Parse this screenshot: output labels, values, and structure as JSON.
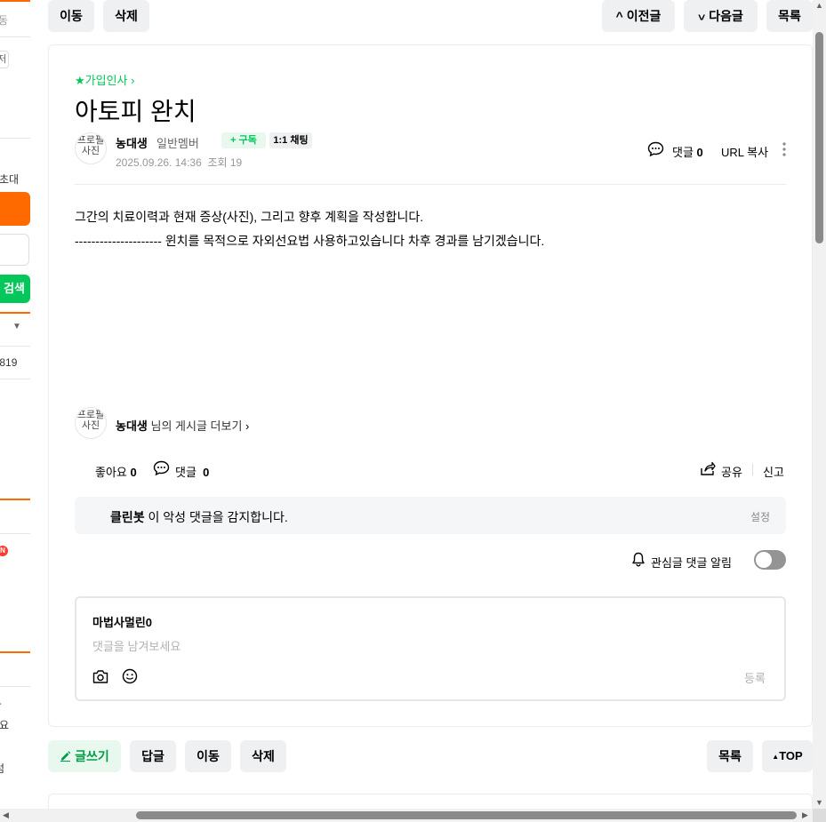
{
  "sidebar": {
    "snippets": [
      "동",
      "니저",
      "초대",
      "검색",
      "819",
      "N",
      "요",
      "럼"
    ]
  },
  "top_bar": {
    "move_label": "이동",
    "delete_label": "삭제",
    "prev_label": "이전글",
    "next_label": "다음글",
    "list_label": "목록"
  },
  "post": {
    "board_link": "★가입인사",
    "title": "아토피 완치",
    "avatar_alt": "프로필 사진",
    "author": "농대생",
    "member_level": "일반멤버",
    "subscribe_label": "구독",
    "chat_label": "1:1 채팅",
    "date": "2025.09.26. 14:36",
    "views_label": "조회",
    "views": "19",
    "comment_label": "댓글",
    "comment_count": "0",
    "url_copy_label": "URL 복사",
    "body_line1": "그간의 치료이력과 현재 증상(사진), 그리고 향후 계획을 작성합니다.",
    "body_line2": "--------------------- 윈치를 목적으로 자외선요법 사용하고있습니다 차후 경과를 남기겠습니다.",
    "more_posts_suffix": "님의 게시글 더보기"
  },
  "reactions": {
    "like_label": "좋아요",
    "like_count": "0",
    "comment_label": "댓글",
    "comment_count": "0",
    "share_label": "공유",
    "report_label": "신고"
  },
  "cleanbot": {
    "name": "클린봇",
    "text": "이 악성 댓글을 감지합니다.",
    "settings_label": "설정"
  },
  "notify": {
    "label": "관심글 댓글 알림",
    "enabled": false
  },
  "comment_editor": {
    "username": "마법사멀린0",
    "placeholder": "댓글을 남겨보세요",
    "submit_label": "등록"
  },
  "bottom_bar": {
    "write_label": "글쓰기",
    "reply_label": "답글",
    "move_label": "이동",
    "delete_label": "삭제",
    "list_label": "목록",
    "top_label": "TOP"
  },
  "colors": {
    "accent_orange": "#ff6a00",
    "naver_green": "#03c75a",
    "button_gray": "#eff0f2",
    "toggle_off": "#949494"
  }
}
